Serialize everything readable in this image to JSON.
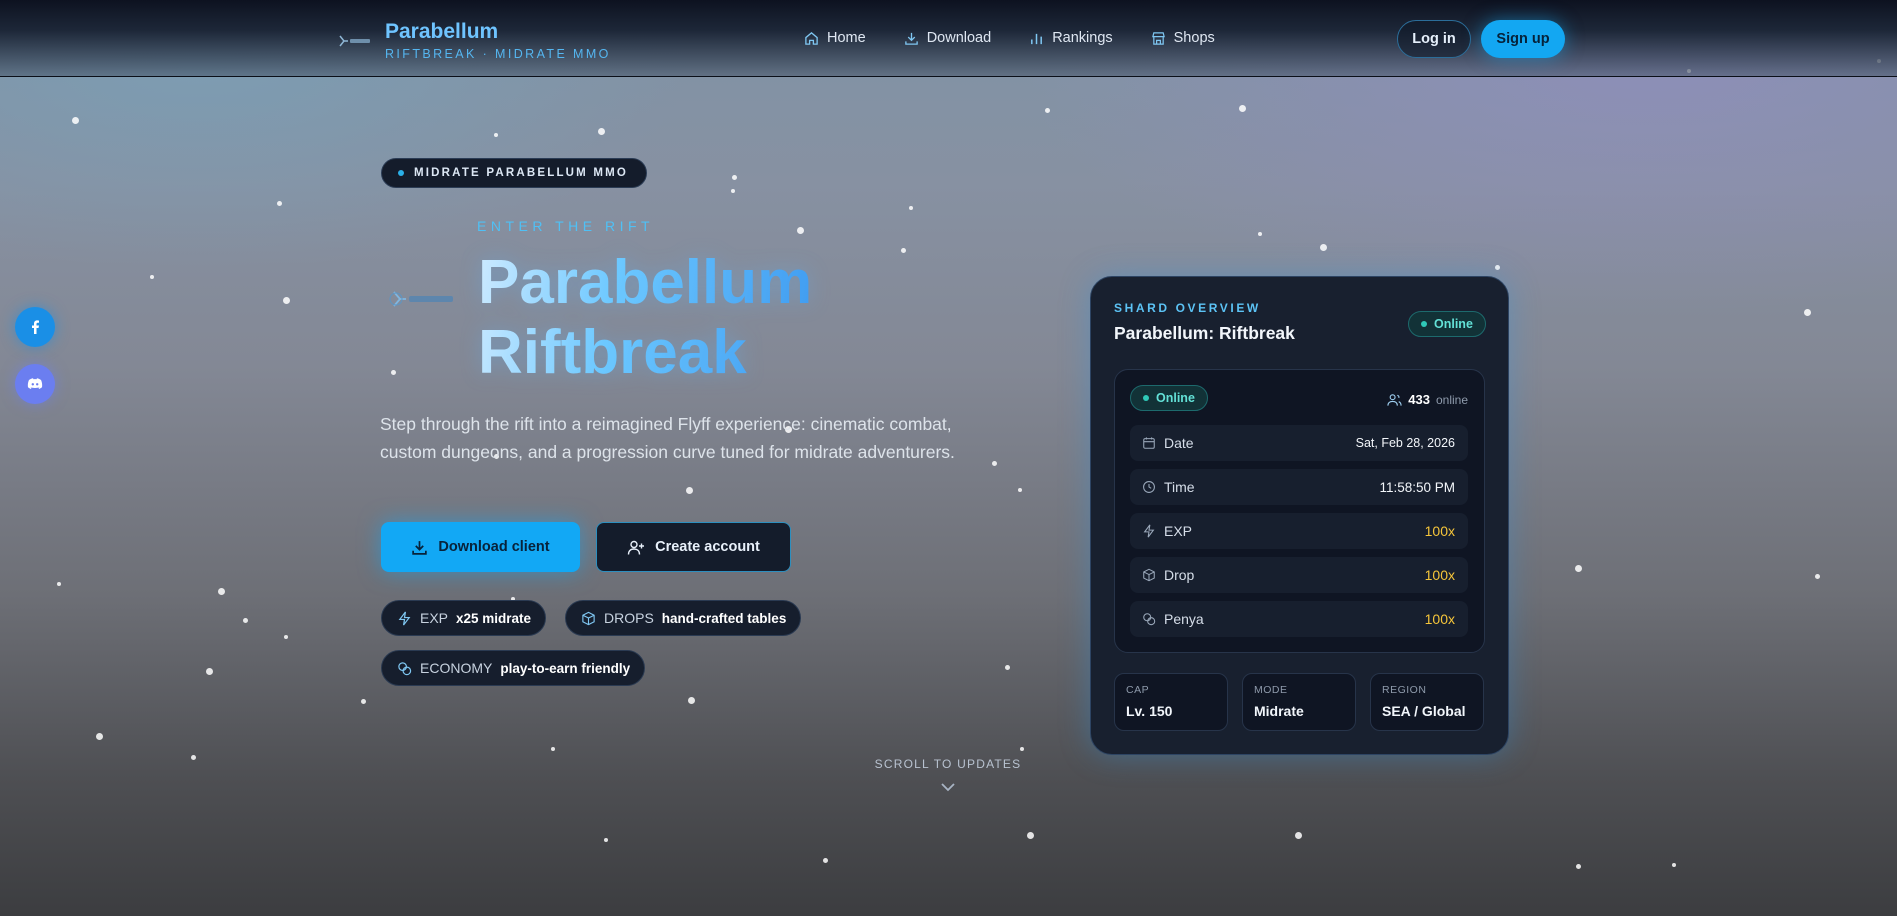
{
  "header": {
    "brand_name": "Parabellum",
    "brand_sub": "RIFTBREAK · MIDRATE MMO",
    "nav": [
      {
        "label": "Home",
        "icon": "home-icon"
      },
      {
        "label": "Download",
        "icon": "download-icon"
      },
      {
        "label": "Rankings",
        "icon": "bar-chart-icon"
      },
      {
        "label": "Shops",
        "icon": "store-icon"
      }
    ],
    "login_label": "Log in",
    "signup_label": "Sign up"
  },
  "social": [
    {
      "name": "facebook",
      "icon": "facebook-icon",
      "color": "#1a8fe6"
    },
    {
      "name": "discord",
      "icon": "discord-icon",
      "color": "#6b7ef0"
    }
  ],
  "hero": {
    "pill": "MIDRATE PARABELLUM MMO",
    "kicker": "ENTER THE RIFT",
    "title_line1": "Parabellum",
    "title_line2": "Riftbreak",
    "description": "Step through the rift into a reimagined Flyff experience: cinematic combat, custom dungeons, and a progression curve tuned for midrate adventurers.",
    "download_label": "Download client",
    "create_label": "Create account",
    "chips": [
      {
        "key": "EXP",
        "value": "x25 midrate",
        "icon": "lightning-icon"
      },
      {
        "key": "DROPS",
        "value": "hand-crafted tables",
        "icon": "box-icon"
      },
      {
        "key": "ECONOMY",
        "value": "play-to-earn friendly",
        "icon": "coins-icon"
      }
    ],
    "scroll_hint": "SCROLL TO UPDATES"
  },
  "card": {
    "kicker": "SHARD OVERVIEW",
    "title": "Parabellum: Riftbreak",
    "status": "Online",
    "inner_status": "Online",
    "players_count": "433",
    "players_label": "online",
    "rows": [
      {
        "label": "Date",
        "value": "Sat, Feb 28, 2026",
        "icon": "calendar-icon"
      },
      {
        "label": "Time",
        "value": "11:58:50 PM",
        "icon": "clock-icon"
      },
      {
        "label": "EXP",
        "value": "100x",
        "icon": "lightning-icon"
      },
      {
        "label": "Drop",
        "value": "100x",
        "icon": "box-icon"
      },
      {
        "label": "Penya",
        "value": "100x",
        "icon": "coins-icon"
      }
    ],
    "stats": [
      {
        "label": "CAP",
        "value": "Lv. 150"
      },
      {
        "label": "MODE",
        "value": "Midrate"
      },
      {
        "label": "REGION",
        "value": "SEA / Global"
      }
    ]
  },
  "colors": {
    "accent": "#12a8f5",
    "rate": "#f5c53a",
    "online": "#63e1d7"
  }
}
